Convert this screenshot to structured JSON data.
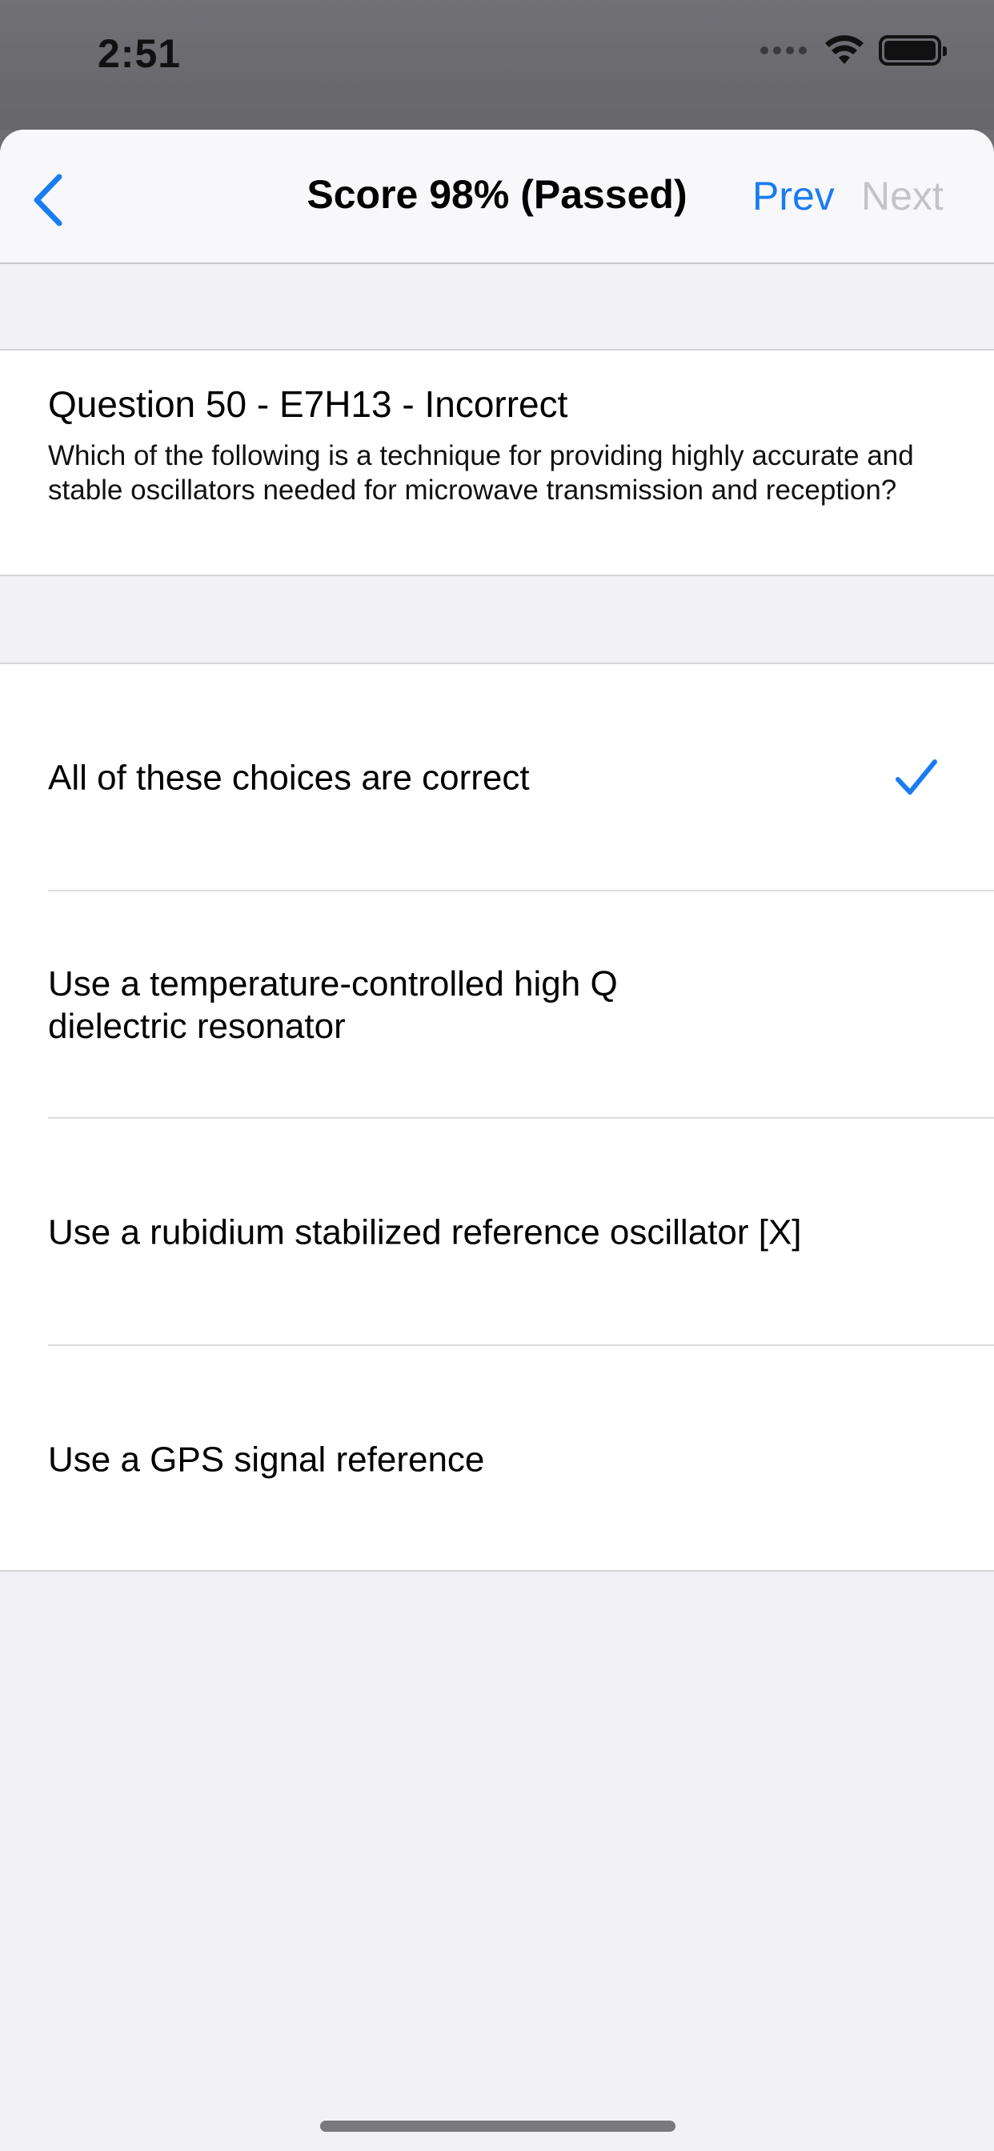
{
  "status_bar": {
    "time": "2:51",
    "icons": [
      "signal-dots-icon",
      "wifi-icon",
      "battery-icon"
    ]
  },
  "navbar": {
    "back_icon": "chevron-left-icon",
    "title": "Score 98% (Passed)",
    "prev_label": "Prev",
    "next_label": "Next",
    "accent_color": "#1a7cf2",
    "disabled_color": "#c4c4c8"
  },
  "question": {
    "heading": "Question 50 - E7H13 - Incorrect",
    "text": "Which of the following is a technique for providing highly accurate and stable oscillators needed for microwave transmission and reception?"
  },
  "choices": [
    {
      "label": "All of these choices are correct",
      "selected": true,
      "icon": "checkmark-icon"
    },
    {
      "label": "Use a temperature-controlled high Q dielectric resonator",
      "selected": false
    },
    {
      "label": "Use a rubidium stabilized reference oscillator [X]",
      "selected": false
    },
    {
      "label": "Use a GPS signal reference",
      "selected": false
    }
  ]
}
